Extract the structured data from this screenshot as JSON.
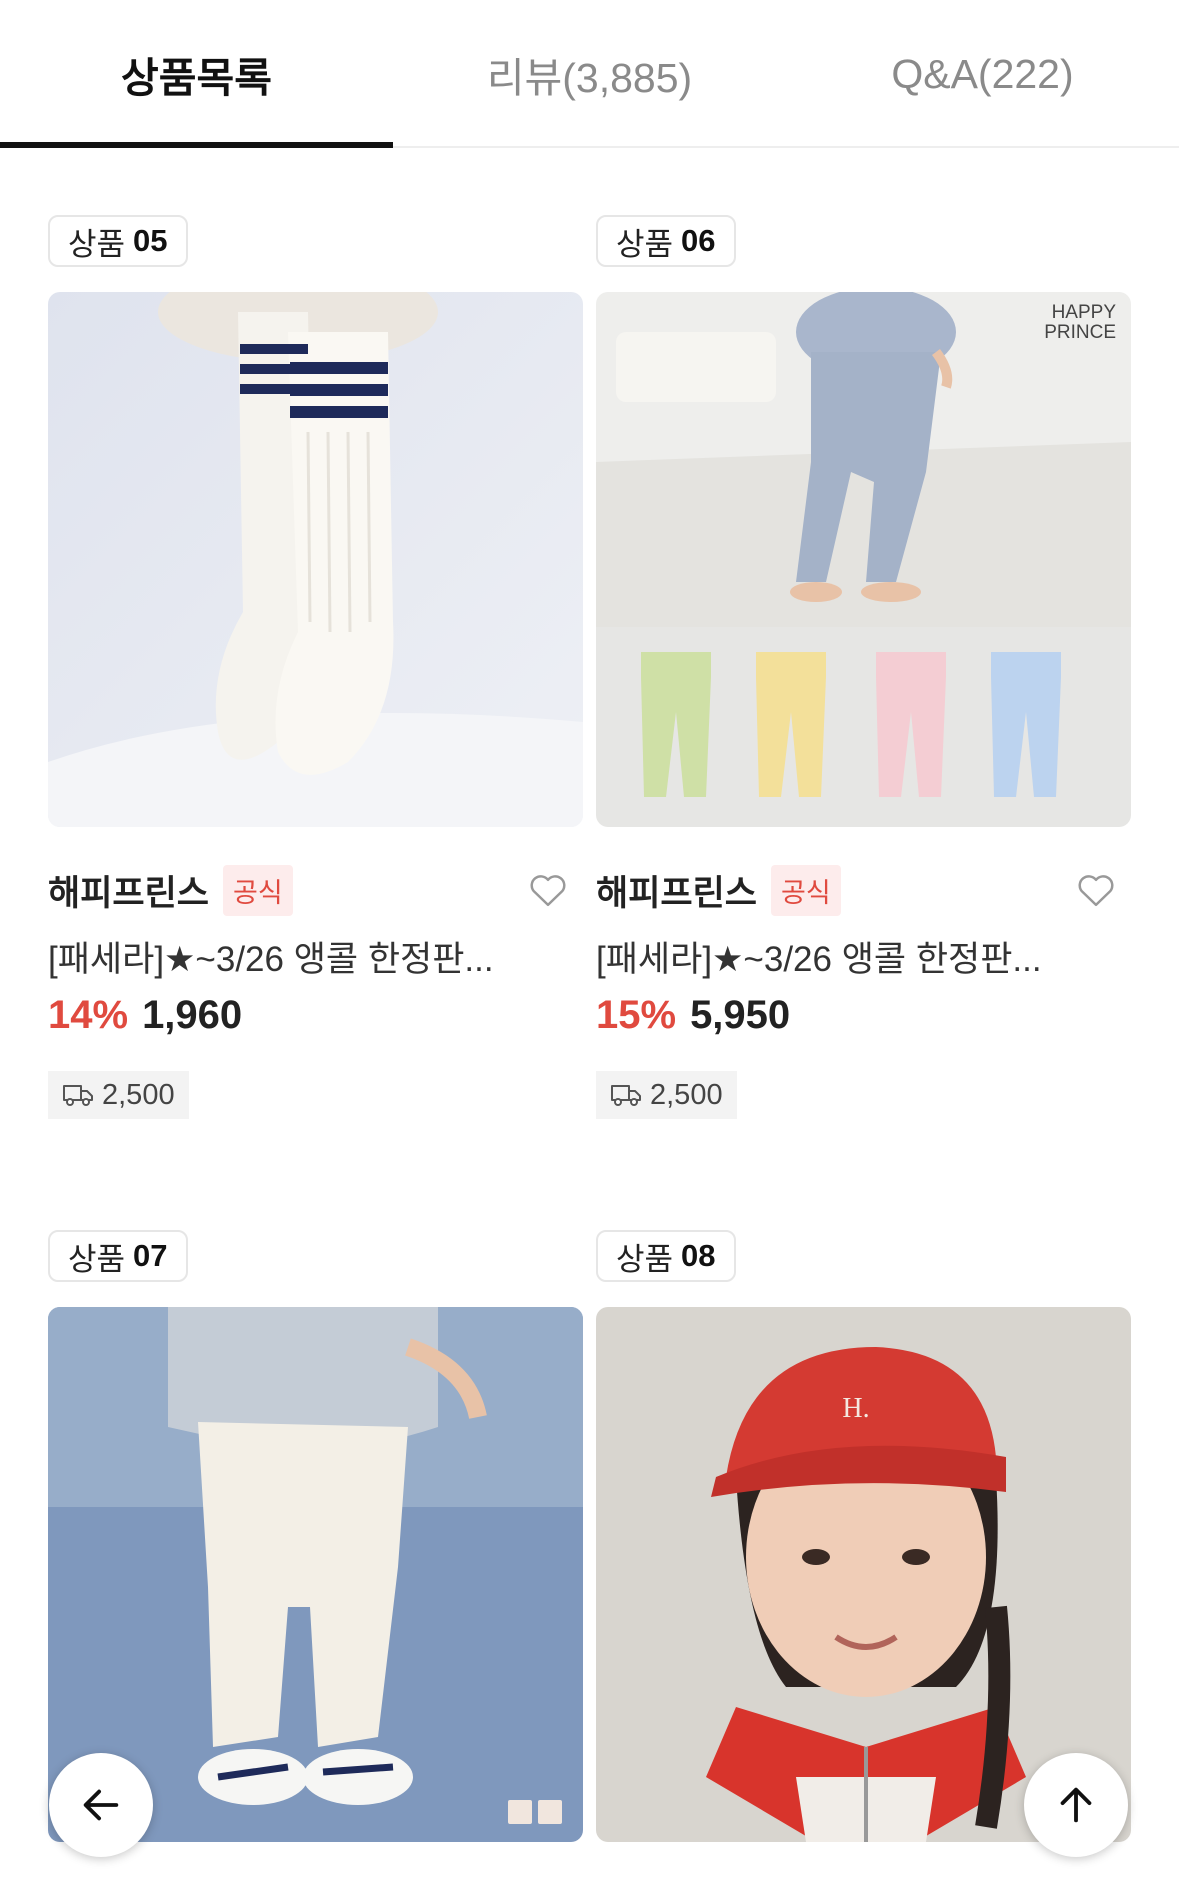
{
  "tabs": [
    {
      "label": "상품목록",
      "active": true
    },
    {
      "label": "리뷰(3,885)",
      "active": false
    },
    {
      "label": "Q&A(222)",
      "active": false
    }
  ],
  "products": [
    {
      "label_prefix": "상품",
      "label_num": "05",
      "brand": "해피프린스",
      "badge": "공식",
      "title": "[패세라]★~3/26 앵콜 한정판...",
      "discount": "14%",
      "price": "1,960",
      "shipping": "2,500"
    },
    {
      "label_prefix": "상품",
      "label_num": "06",
      "brand": "해피프린스",
      "badge": "공식",
      "title": "[패세라]★~3/26 앵콜 한정판...",
      "discount": "15%",
      "price": "5,950",
      "shipping": "2,500",
      "watermark": [
        "HAPPY",
        "PRINCE"
      ]
    },
    {
      "label_prefix": "상품",
      "label_num": "07"
    },
    {
      "label_prefix": "상품",
      "label_num": "08"
    }
  ],
  "colors": {
    "accent_red": "#e04a3f",
    "badge_bg": "#fdecec"
  },
  "icons": {
    "back": "arrow-left-icon",
    "top": "arrow-up-icon",
    "wishlist": "heart-icon",
    "shipping": "truck-icon"
  }
}
